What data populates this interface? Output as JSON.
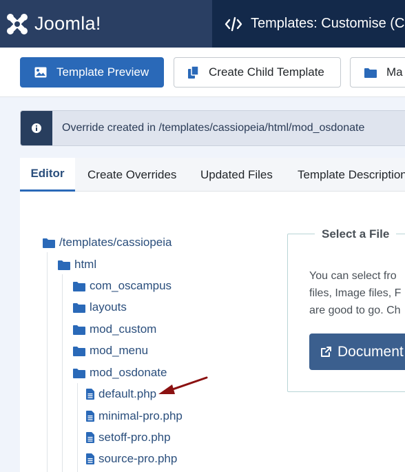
{
  "header": {
    "logo_text": "Joomla!",
    "title": "Templates: Customise (C"
  },
  "toolbar": {
    "preview_label": "Template Preview",
    "child_label": "Create Child Template",
    "manage_label": "Ma"
  },
  "alert": {
    "message": "Override created in /templates/cassiopeia/html/mod_osdonate"
  },
  "tabs": {
    "editor": "Editor",
    "create_overrides": "Create Overrides",
    "updated_files": "Updated Files",
    "template_description": "Template Description"
  },
  "tree": {
    "root": "/templates/cassiopeia",
    "html": "html",
    "com_oscampus": "com_oscampus",
    "layouts": "layouts",
    "mod_custom": "mod_custom",
    "mod_menu": "mod_menu",
    "mod_osdonate": "mod_osdonate",
    "files": [
      "default.php",
      "minimal-pro.php",
      "setoff-pro.php",
      "source-pro.php"
    ]
  },
  "select_file": {
    "legend": "Select a File",
    "line1": "You can select fro",
    "line2": "files, Image files, F",
    "line3": "are good to go. Ch",
    "doc_button": "Document"
  },
  "colors": {
    "brand_dark": "#13294a",
    "logo_bg": "#2a3f63",
    "primary": "#2a69b8",
    "link": "#2a4e7c",
    "arrow": "#8b1111"
  }
}
